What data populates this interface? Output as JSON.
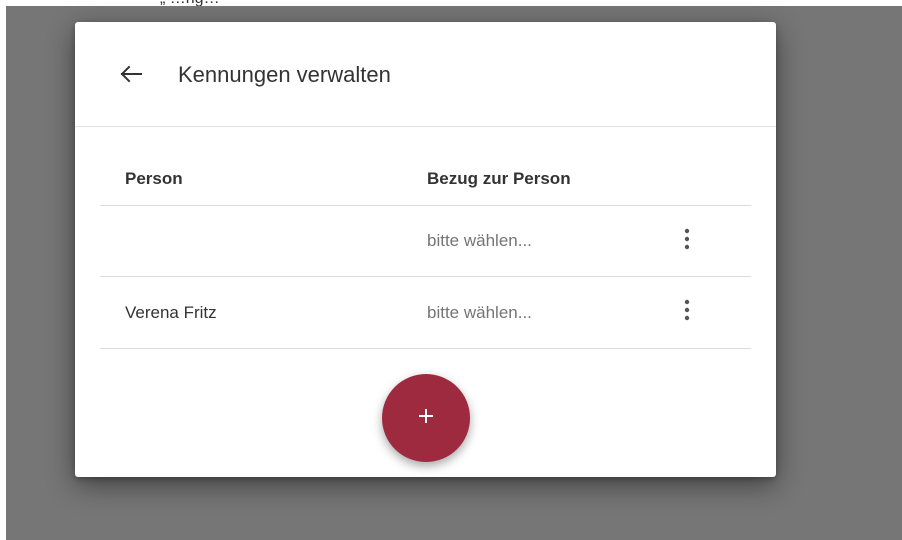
{
  "top_strip": {
    "text": "„ …ng…"
  },
  "dialog": {
    "title": "Kennungen verwalten",
    "back_icon": "arrow-left-icon"
  },
  "table": {
    "columns": [
      "Person",
      "Bezug zur Person"
    ],
    "rows": [
      {
        "person": "",
        "bezug": "bitte wählen..."
      },
      {
        "person": "Verena Fritz",
        "bezug": "bitte wählen..."
      }
    ],
    "row_menu_icon": "more-vert-icon"
  },
  "fab": {
    "icon": "plus-icon",
    "label": "+"
  },
  "colors": {
    "backdrop": "#767676",
    "accent": "#9e2a3f",
    "placeholder_text": "#757575",
    "divider": "#dcdcdc"
  }
}
